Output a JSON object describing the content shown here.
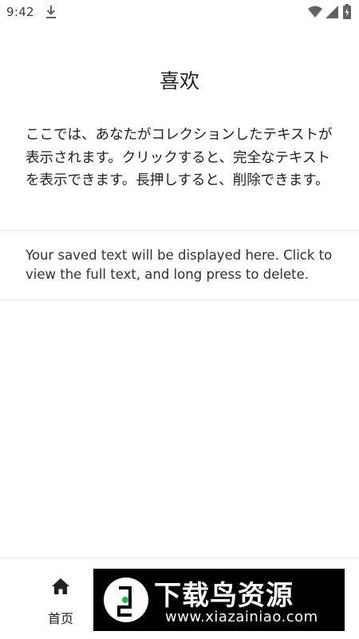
{
  "status_bar": {
    "time": "9:42",
    "icons": [
      "download-icon",
      "wifi-icon",
      "signal-icon",
      "battery-icon"
    ]
  },
  "page": {
    "title": "喜欢",
    "description_ja": "ここでは、あなたがコレクションしたテキストが表示されます。クリックすると、完全なテキストを表示できます。長押しすると、削除できます。",
    "description_en": "Your saved text will be displayed here. Click to view the full text, and long press to delete."
  },
  "bottom_nav": {
    "items": [
      {
        "label": "首页",
        "icon": "home-icon"
      }
    ]
  },
  "watermark": {
    "title": "下载鸟资源",
    "url": "www.xiazainiao.com"
  },
  "colors": {
    "text": "#202124",
    "divider": "#e6e6e6",
    "background": "#ffffff",
    "watermark_bg": "#000000"
  }
}
